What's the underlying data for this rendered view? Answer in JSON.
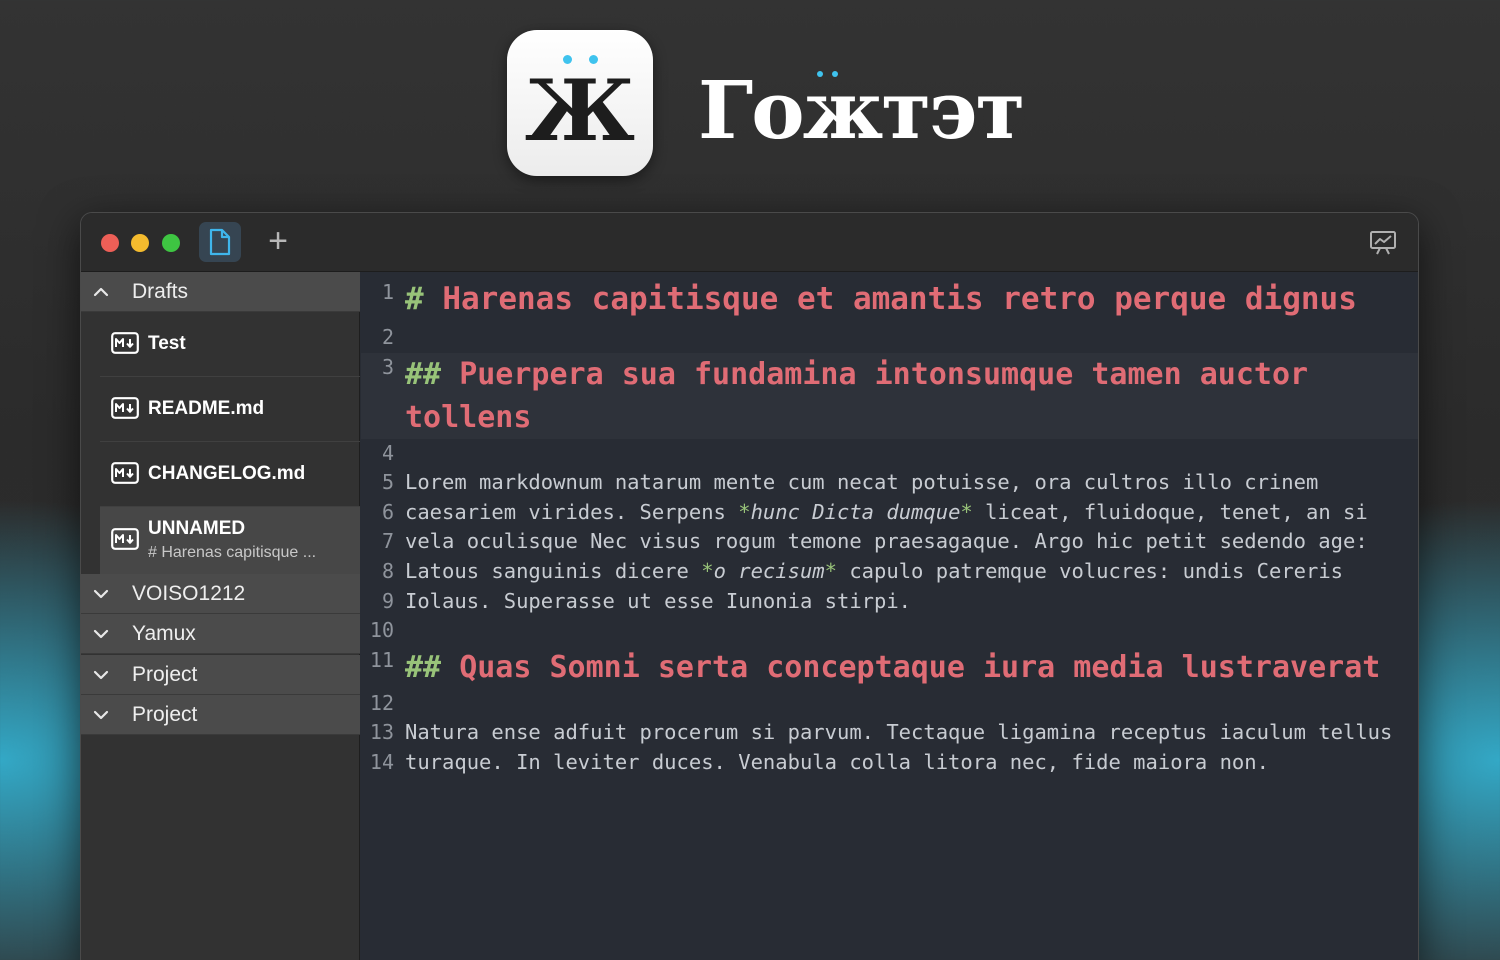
{
  "hero": {
    "icon_glyph": "Ж",
    "title": "Гожтэт",
    "accent_color": "#3fc3ee"
  },
  "window": {
    "titlebar": {
      "tab_icon": "document-icon",
      "add_label": "+",
      "right_icon": "presentation-icon"
    },
    "sidebar": {
      "groups": [
        {
          "label": "Drafts",
          "expanded": true
        },
        {
          "label": "VOISO1212",
          "expanded": false
        },
        {
          "label": "Yamux",
          "expanded": false
        },
        {
          "label": "Project",
          "expanded": false
        },
        {
          "label": "Project",
          "expanded": false
        }
      ],
      "files": [
        {
          "name": "Test"
        },
        {
          "name": "README.md"
        },
        {
          "name": "CHANGELOG.md"
        },
        {
          "name": "UNNAMED",
          "preview": "# Harenas capitisque ...",
          "selected": true
        }
      ]
    },
    "editor": {
      "colors": {
        "heading": "#e06c75",
        "markup": "#98c379",
        "text": "#c8ccd2",
        "line_number": "#8f949c"
      },
      "lines": {
        "n1": "1",
        "n2": "2",
        "n3": "3",
        "n4": "4",
        "n5": "5",
        "n6": "6",
        "n7": "7",
        "n8": "8",
        "n9": "9",
        "n10": "10",
        "n11": "11",
        "n12": "12",
        "n13": "13",
        "n14": "14",
        "l1_mark": "#",
        "l1_text": "Harenas capitisque et amantis retro perque dignus",
        "l3_mark": "##",
        "l3_text": "Puerpera sua fundamina intonsumque tamen auctor tollens",
        "l5_text": "Lorem markdownum natarum mente cum necat potuisse, ora cultros illo crinem",
        "l6_pre": "caesariem virides. Serpens ",
        "l6_em_open": "*",
        "l6_em": "hunc Dicta dumque",
        "l6_em_close": "*",
        "l6_post": " liceat, fluidoque, tenet, an si",
        "l7_text": "vela oculisque Nec visus rogum temone praesagaque. Argo hic petit sedendo age:",
        "l8_pre": "Latous sanguinis dicere ",
        "l8_em_open": "*",
        "l8_em": "o recisum",
        "l8_em_close": "*",
        "l8_post": " capulo patremque volucres: undis Cereris",
        "l9_text": "Iolaus. Superasse ut esse Iunonia stirpi.",
        "l11_mark": "##",
        "l11_text": "Quas Somni serta conceptaque iura media lustraverat",
        "l13_text": "Natura ense adfuit procerum si parvum. Tectaque ligamina receptus iaculum tellus",
        "l14_text": "turaque. In leviter duces. Venabula colla litora nec, fide maiora non."
      }
    }
  }
}
